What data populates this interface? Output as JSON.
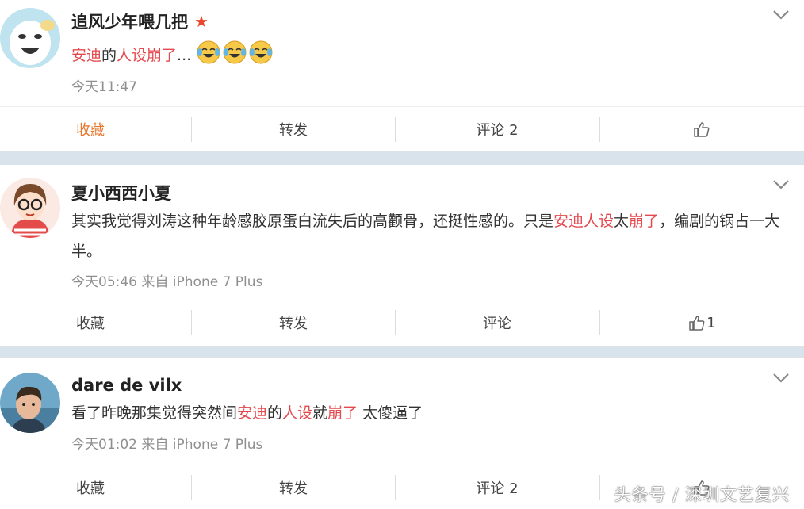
{
  "posts": [
    {
      "author": "追风少年喂几把",
      "content_segments": [
        {
          "text": "安迪",
          "hl": true
        },
        {
          "text": "的",
          "hl": false
        },
        {
          "text": "人设崩了",
          "hl": true
        },
        {
          "text": "...",
          "hl": false
        }
      ],
      "emoji_count": 3,
      "meta": "今天11:47",
      "actions": {
        "favorite": "收藏",
        "repost": "转发",
        "comment": "评论 2",
        "like": ""
      }
    },
    {
      "author": "夏小西西小夏",
      "content_segments": [
        {
          "text": "其实我觉得刘涛这种年龄感胶原蛋白流失后的高颧骨，还挺性感的。只是",
          "hl": false
        },
        {
          "text": "安迪人设",
          "hl": true
        },
        {
          "text": "太",
          "hl": false
        },
        {
          "text": "崩了",
          "hl": true
        },
        {
          "text": "，编剧的锅占一大半。",
          "hl": false
        }
      ],
      "meta": "今天05:46 来自 iPhone 7 Plus",
      "actions": {
        "favorite": "收藏",
        "repost": "转发",
        "comment": "评论",
        "like": "1"
      }
    },
    {
      "author": "dare de vilx",
      "content_segments": [
        {
          "text": "看了昨晚那集觉得突然间",
          "hl": false
        },
        {
          "text": "安迪",
          "hl": true
        },
        {
          "text": "的",
          "hl": false
        },
        {
          "text": "人设",
          "hl": true
        },
        {
          "text": "就",
          "hl": false
        },
        {
          "text": "崩了",
          "hl": true
        },
        {
          "text": " 太傻逼了",
          "hl": false
        }
      ],
      "meta": "今天01:02 来自 iPhone 7 Plus",
      "actions": {
        "favorite": "收藏",
        "repost": "转发",
        "comment": "评论 2",
        "like": ""
      }
    }
  ],
  "watermark": "头条号 / 深圳文艺复兴",
  "colors": {
    "highlight": "#e5484d",
    "favorite_active": "#e8762c",
    "divider": "#d9e3ec",
    "meta_text": "#8f8f8f"
  },
  "icons": {
    "vip_badge": "star-icon",
    "expand": "chevron-down-icon",
    "like": "thumbs-up-icon",
    "emoji": "laugh-cry-emoji-icon"
  }
}
